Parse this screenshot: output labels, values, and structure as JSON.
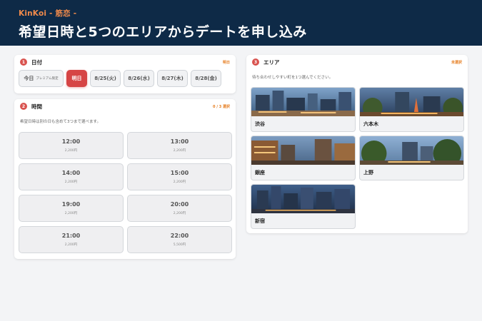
{
  "header": {
    "brand": "KinKoi - 筋恋 -",
    "title": "希望日時と5つのエリアからデートを申し込み"
  },
  "date_section": {
    "number": "1",
    "title": "日付",
    "status": "明日",
    "dates": [
      {
        "label": "今日",
        "note": "プレミアム限定",
        "selected": false
      },
      {
        "label": "明日",
        "selected": true
      },
      {
        "label": "8/25(火)",
        "selected": false
      },
      {
        "label": "8/26(水)",
        "selected": false
      },
      {
        "label": "8/27(木)",
        "selected": false
      },
      {
        "label": "8/28(金)",
        "selected": false
      }
    ]
  },
  "time_section": {
    "number": "2",
    "title": "時間",
    "status": "0 / 3 選択",
    "description": "希望日時は別の日も含めて3つまで選べます。",
    "slots": [
      {
        "time": "12:00",
        "price": "2,200円"
      },
      {
        "time": "13:00",
        "price": "2,200円"
      },
      {
        "time": "14:00",
        "price": "2,200円"
      },
      {
        "time": "15:00",
        "price": "2,200円"
      },
      {
        "time": "19:00",
        "price": "2,200円"
      },
      {
        "time": "20:00",
        "price": "2,200円"
      },
      {
        "time": "21:00",
        "price": "2,200円"
      },
      {
        "time": "22:00",
        "price": "5,500円"
      }
    ]
  },
  "area_section": {
    "number": "3",
    "title": "エリア",
    "status": "未選択",
    "description": "待ち合わせしやすい町を1つ選んでください。",
    "areas": [
      {
        "name": "渋谷"
      },
      {
        "name": "六本木"
      },
      {
        "name": "銀座"
      },
      {
        "name": "上野"
      },
      {
        "name": "新宿"
      }
    ]
  },
  "colors": {
    "header_bg": "#0e2a47",
    "brand": "#f08a4b",
    "accent": "#d64545",
    "status": "#e67e22"
  }
}
